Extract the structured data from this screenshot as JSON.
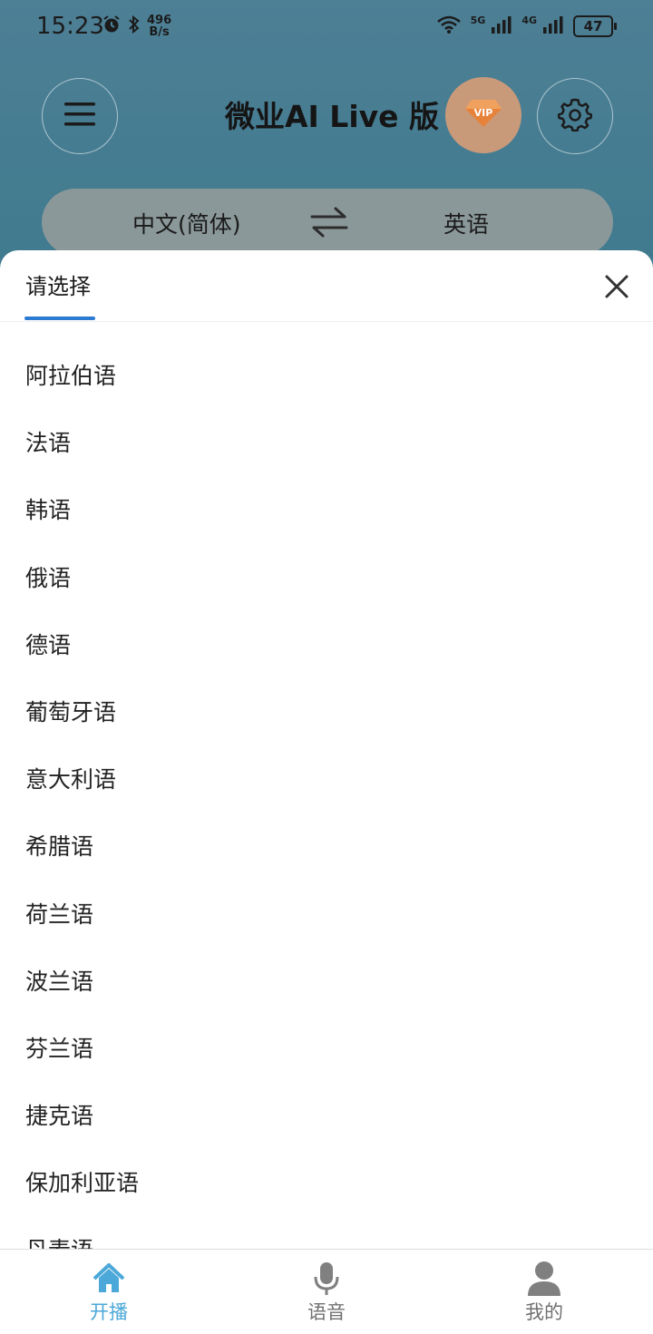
{
  "status_bar": {
    "time": "15:23",
    "net_speed_value": "496",
    "net_speed_unit": "B/s",
    "signal_1": "5G",
    "signal_2": "4G",
    "battery": "47"
  },
  "header": {
    "title": "微业AI Live 版",
    "vip_label": "VIP",
    "menu_icon": "hamburger-icon",
    "settings_icon": "gear-icon"
  },
  "language_bar": {
    "source": "中文(简体)",
    "target": "英语",
    "swap_icon": "swap-arrows-icon"
  },
  "sheet": {
    "tab": "请选择",
    "close_icon": "close-icon",
    "languages": [
      "阿拉伯语",
      "法语",
      "韩语",
      "俄语",
      "德语",
      "葡萄牙语",
      "意大利语",
      "希腊语",
      "荷兰语",
      "波兰语",
      "芬兰语",
      "捷克语",
      "保加利亚语",
      "丹麦语"
    ]
  },
  "bottom_nav": {
    "active_color": "#4ba8d8",
    "items": [
      {
        "label": "开播",
        "icon": "home-icon"
      },
      {
        "label": "语音",
        "icon": "microphone-icon"
      },
      {
        "label": "我的",
        "icon": "person-icon"
      }
    ]
  }
}
